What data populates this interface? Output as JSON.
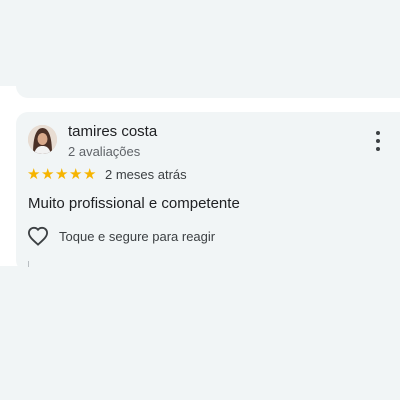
{
  "review": {
    "author": "tamires costa",
    "review_count": "2 avaliações",
    "rating": 5,
    "stars": [
      "★",
      "★",
      "★",
      "★",
      "★"
    ],
    "time_ago": "2 meses atrás",
    "text": "Muito profissional e competente",
    "react_hint": "Toque e segure para reagir",
    "avatar_icon": "user-photo-avatar",
    "menu_icon": "more-vert-icon",
    "like_icon": "heart-outline-icon"
  },
  "colors": {
    "card_background": "#f1f5f6",
    "star": "#f6b400",
    "text_primary": "#202124",
    "text_secondary": "#5f6368"
  }
}
